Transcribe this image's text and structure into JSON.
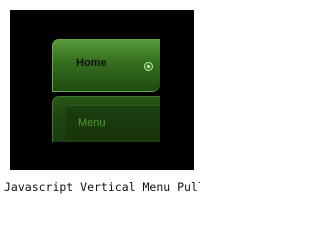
{
  "menu": {
    "items": [
      {
        "label": "Home",
        "selected": true
      },
      {
        "label": "Menu",
        "selected": false
      }
    ]
  },
  "caption": "Javascript Vertical Menu Pull ...",
  "colors": {
    "frame_background": "#000000",
    "active_item_green": "#3d7a24",
    "inactive_item_green": "#1f4512",
    "inactive_text_green": "#4f9a37"
  },
  "icons": {
    "selected_indicator": "radio-dot-icon"
  }
}
